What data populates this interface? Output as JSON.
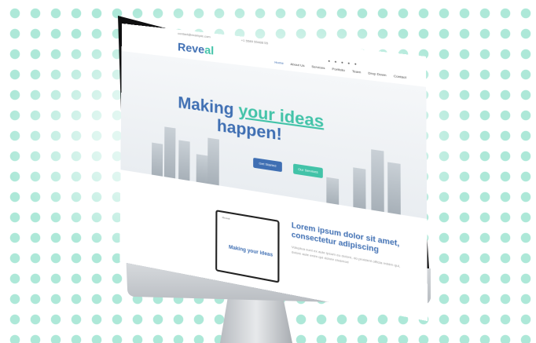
{
  "site": {
    "topbar": {
      "email": "contact@example.com",
      "phone": "+1 5589 55488 55"
    },
    "brand": {
      "prefix": "Reve",
      "accent": "al"
    },
    "nav": [
      "Home",
      "About Us",
      "Services",
      "Portfolio",
      "Team",
      "Drop Down",
      "Contact"
    ],
    "social_icons": [
      "twitter-icon",
      "facebook-icon",
      "instagram-icon",
      "google-plus-icon",
      "linkedin-icon"
    ],
    "hero": {
      "line1_prefix": "Making ",
      "line1_highlight": "your ideas",
      "line2": "happen!",
      "cta_primary": "Get Started",
      "cta_secondary": "Our Services"
    },
    "about": {
      "title": "Lorem ipsum dolor sit amet, consectetur adipiscing",
      "text": "Voluptua sunt ex aute ipsum eu dolore, do proident officia minim qui, dolore aute enim qui dolore eiusmod",
      "preview_browser_label": "Reveal",
      "preview_heading": "Making your ideas"
    }
  },
  "colors": {
    "primary": "#3f6fb3",
    "accent": "#42c3a8",
    "dots": "#a9e7d6",
    "bezel": "#111111",
    "stand": "#c9ccd0"
  }
}
